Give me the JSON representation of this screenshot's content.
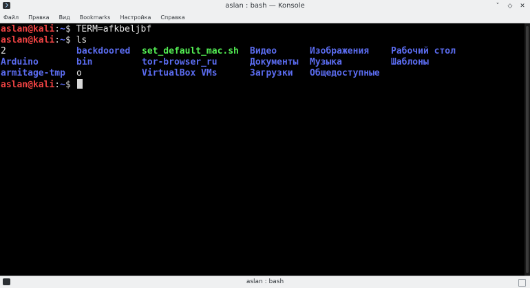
{
  "window": {
    "title": "aslan : bash — Konsole",
    "buttons": [
      "˅",
      "◇",
      "✕"
    ]
  },
  "menu": [
    "Файл",
    "Правка",
    "Вид",
    "Bookmarks",
    "Настройка",
    "Справка"
  ],
  "terminal": {
    "prompt": {
      "user_host": "aslan@kali",
      "sep": ":",
      "path": "~",
      "symbol": "$ "
    },
    "commands": [
      "TERM=afkbeljbf",
      "ls",
      ""
    ],
    "ls_rows": [
      [
        {
          "text": "2",
          "kind": "file"
        },
        {
          "text": "backdoored",
          "kind": "dir"
        },
        {
          "text": "set_default_mac.sh",
          "kind": "exec"
        },
        {
          "text": "Видео",
          "kind": "dir"
        },
        {
          "text": "Изображения",
          "kind": "dir"
        },
        {
          "text": "Рабочий стол",
          "kind": "dir"
        }
      ],
      [
        {
          "text": "Arduino",
          "kind": "dir"
        },
        {
          "text": "bin",
          "kind": "dir"
        },
        {
          "text": "tor-browser_ru",
          "kind": "dir"
        },
        {
          "text": "Документы",
          "kind": "dir"
        },
        {
          "text": "Музыка",
          "kind": "dir"
        },
        {
          "text": "Шаблоны",
          "kind": "dir"
        }
      ],
      [
        {
          "text": "armitage-tmp",
          "kind": "dir"
        },
        {
          "text": "o",
          "kind": "file"
        },
        {
          "text": "VirtualBox VMs",
          "kind": "dir"
        },
        {
          "text": "Загрузки",
          "kind": "dir"
        },
        {
          "text": "Общедоступные",
          "kind": "dir"
        }
      ]
    ]
  },
  "tab": {
    "label": "aslan : bash"
  },
  "colors": {
    "user": "#f04343",
    "path": "#5b6cf0",
    "dir": "#5b6cf0",
    "exec": "#54f054",
    "bg": "#000000"
  }
}
